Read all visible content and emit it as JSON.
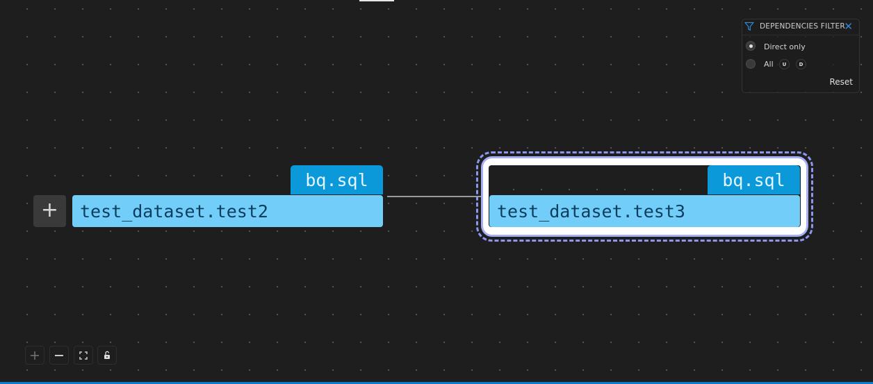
{
  "filter": {
    "title": "DEPENDENCIES FILTER",
    "close_icon": "close-icon",
    "options": [
      {
        "label": "Direct only",
        "selected": true
      },
      {
        "label": "All",
        "selected": false
      }
    ],
    "direction_pills": [
      "U",
      "D"
    ],
    "reset_label": "Reset",
    "accent": "#2f88d6"
  },
  "nodes": [
    {
      "name": "test_dataset.test2",
      "tag": "bq.sql",
      "selected": false,
      "expand_label": "+"
    },
    {
      "name": "test_dataset.test3",
      "tag": "bq.sql",
      "selected": true
    }
  ],
  "colors": {
    "tag": "#0b99d9",
    "node": "#72cef9",
    "selection": "#8b97ee",
    "background": "#1e1e1e",
    "status_bar": "#0e7acb"
  },
  "controls": [
    {
      "name": "zoom-in",
      "icon": "plus-icon"
    },
    {
      "name": "zoom-out",
      "icon": "minus-icon"
    },
    {
      "name": "fit-view",
      "icon": "fit-view-icon"
    },
    {
      "name": "toggle-lock",
      "icon": "unlock-icon"
    }
  ]
}
